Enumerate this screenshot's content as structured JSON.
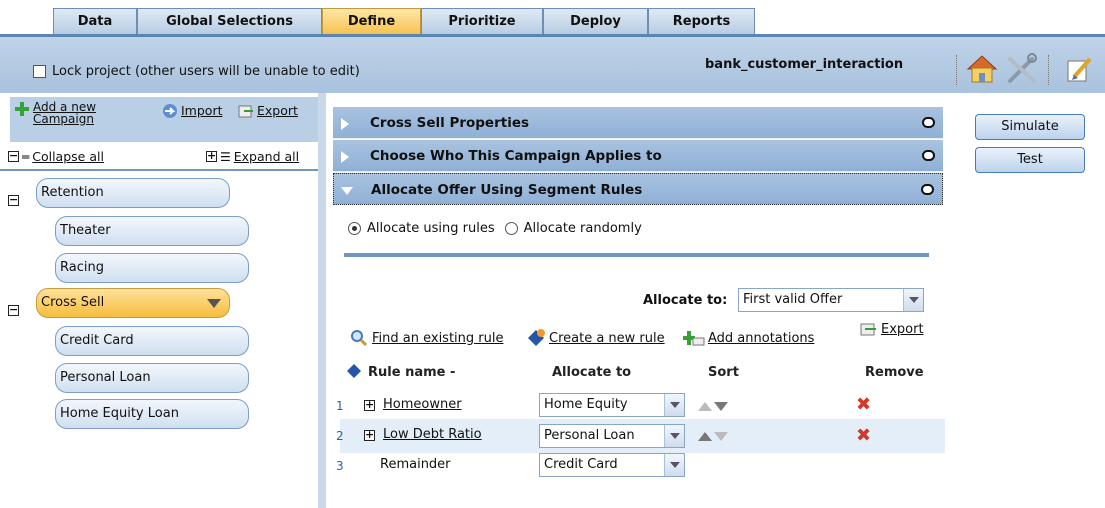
{
  "tabs": [
    "Data",
    "Global Selections",
    "Define",
    "Prioritize",
    "Deploy",
    "Reports"
  ],
  "active_tab": "Define",
  "project": {
    "lock_label": "Lock project (other users will be unable to edit)",
    "name": "bank_customer_interaction"
  },
  "toolbar_icons": [
    "home-icon",
    "tools-icon",
    "edit-icon"
  ],
  "left": {
    "add_campaign": "Add a new\nCampaign",
    "import": "Import",
    "export": "Export",
    "collapse_all": "Collapse all",
    "expand_all": "Expand all",
    "tree": [
      {
        "label": "Retention",
        "children": [
          "Theater",
          "Racing"
        ]
      },
      {
        "label": "Cross Sell",
        "children": [
          "Credit Card",
          "Personal Loan",
          "Home Equity Loan"
        ]
      }
    ]
  },
  "accordions": [
    "Cross Sell Properties",
    "Choose Who This Campaign Applies to",
    "Allocate Offer Using Segment Rules"
  ],
  "allocation": {
    "option_rules": "Allocate using rules",
    "option_random": "Allocate randomly",
    "allocate_to_label": "Allocate to:",
    "allocate_to_value": "First valid Offer",
    "find_rule": "Find an existing rule",
    "create_rule": "Create a new rule",
    "add_annotations": "Add annotations",
    "export": "Export"
  },
  "rules_table": {
    "headers": [
      "Rule name -",
      "Allocate to",
      "Sort",
      "Remove"
    ],
    "rows": [
      {
        "num": "1",
        "name": "Homeowner",
        "allocate": "Home Equity"
      },
      {
        "num": "2",
        "name": "Low Debt Ratio",
        "allocate": "Personal Loan"
      },
      {
        "num": "3",
        "name": "Remainder",
        "allocate": "Credit Card"
      }
    ]
  },
  "buttons": {
    "simulate": "Simulate",
    "test": "Test"
  },
  "colors": {
    "accent_blue": "#8fb0d6",
    "active_tab": "#f6c24f",
    "remove_red": "#d2382b"
  }
}
